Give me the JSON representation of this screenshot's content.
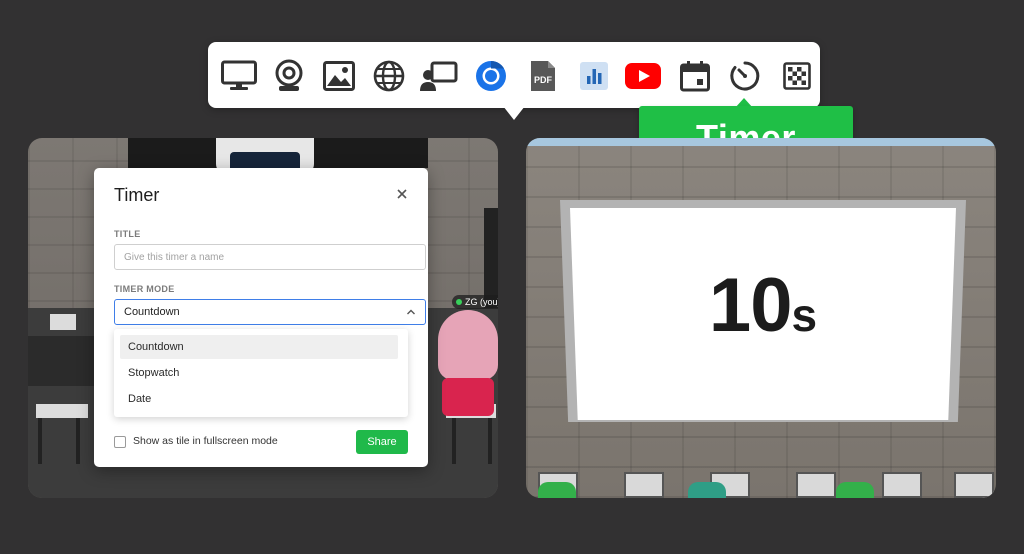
{
  "toolbar": {
    "items": [
      {
        "name": "Screen share"
      },
      {
        "name": "Camera"
      },
      {
        "name": "Image"
      },
      {
        "name": "Website"
      },
      {
        "name": "Presenter"
      },
      {
        "name": "Chrome"
      },
      {
        "name": "PDF"
      },
      {
        "name": "Chart"
      },
      {
        "name": "YouTube"
      },
      {
        "name": "Calendar"
      },
      {
        "name": "Timer"
      },
      {
        "name": "Whiteboard"
      }
    ],
    "tooltip": "Timer"
  },
  "modal": {
    "title": "Timer",
    "title_label": "TITLE",
    "title_placeholder": "Give this timer a name",
    "mode_label": "TIMER MODE",
    "mode_value": "Countdown",
    "options": [
      "Countdown",
      "Stopwatch",
      "Date"
    ],
    "checkbox_label": "Show as tile in fullscreen mode",
    "share_label": "Share"
  },
  "scene": {
    "avatar_tag": "ZG (you)"
  },
  "timer_display": {
    "value": "10",
    "unit": "s"
  },
  "colors": {
    "background": "#323132",
    "accent_green": "#1fbf46",
    "focus_blue": "#3f7ee8"
  }
}
